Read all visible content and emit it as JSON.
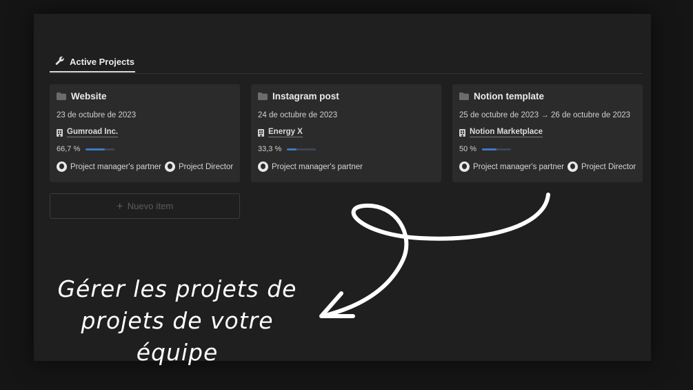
{
  "tab": {
    "label": "Active Projects",
    "icon": "wrench-icon"
  },
  "cards": [
    {
      "title": "Website",
      "date": "23 de octubre de 2023",
      "client": "Gumroad Inc.",
      "progress_text": "66,7 %",
      "progress": 0.667,
      "people": [
        "Project manager's partner",
        "Project Director"
      ]
    },
    {
      "title": "Instagram post",
      "date": "24 de octubre de 2023",
      "client": "Energy X",
      "progress_text": "33,3 %",
      "progress": 0.333,
      "people": [
        "Project manager's partner"
      ]
    },
    {
      "title": "Notion template",
      "date": "25 de octubre de 2023 → 26 de octubre de 2023",
      "client": "Notion Marketplace",
      "progress_text": "50 %",
      "progress": 0.5,
      "people": [
        "Project manager's partner",
        "Project Director"
      ]
    }
  ],
  "new_item": {
    "label": "Nuevo ítem",
    "icon": "plus-icon"
  },
  "caption": {
    "line1": "Gérer les projets de",
    "line2": "projets de votre équipe"
  },
  "colors": {
    "background": "#151515",
    "panel": "#1f1f1f",
    "card": "#2b2b2b",
    "progress_fill": "#3e78c5",
    "caption": "#ffffff"
  }
}
